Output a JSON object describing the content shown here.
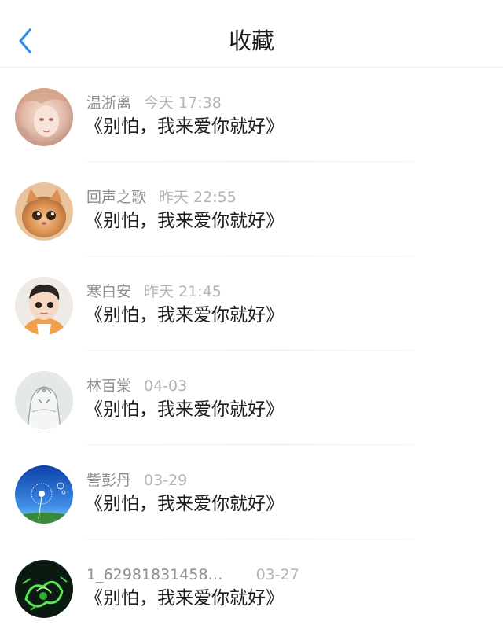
{
  "header": {
    "title": "收藏",
    "back_icon": "chevron-left-icon",
    "accent_color": "#2d8cf0"
  },
  "favorites": [
    {
      "name": "温浙离",
      "time": "今天 17:38",
      "text": "《别怕，我来爱你就好》",
      "avatar_icon": "avatar-anime-girl"
    },
    {
      "name": "回声之歌",
      "time": "昨天 22:55",
      "text": "《别怕，我来爱你就好》",
      "avatar_icon": "avatar-kitten"
    },
    {
      "name": "寒白安",
      "time": "昨天 21:45",
      "text": "《别怕，我来爱你就好》",
      "avatar_icon": "avatar-child"
    },
    {
      "name": "林百棠",
      "time": "04-03",
      "text": "《别怕，我来爱你就好》",
      "avatar_icon": "avatar-sketch"
    },
    {
      "name": "訾彭丹",
      "time": "03-29",
      "text": "《别怕，我来爱你就好》",
      "avatar_icon": "avatar-dandelion"
    },
    {
      "name": "1_62981831458…",
      "time": "03-27",
      "text": "《别怕，我来爱你就好》",
      "avatar_icon": "avatar-neon"
    }
  ]
}
